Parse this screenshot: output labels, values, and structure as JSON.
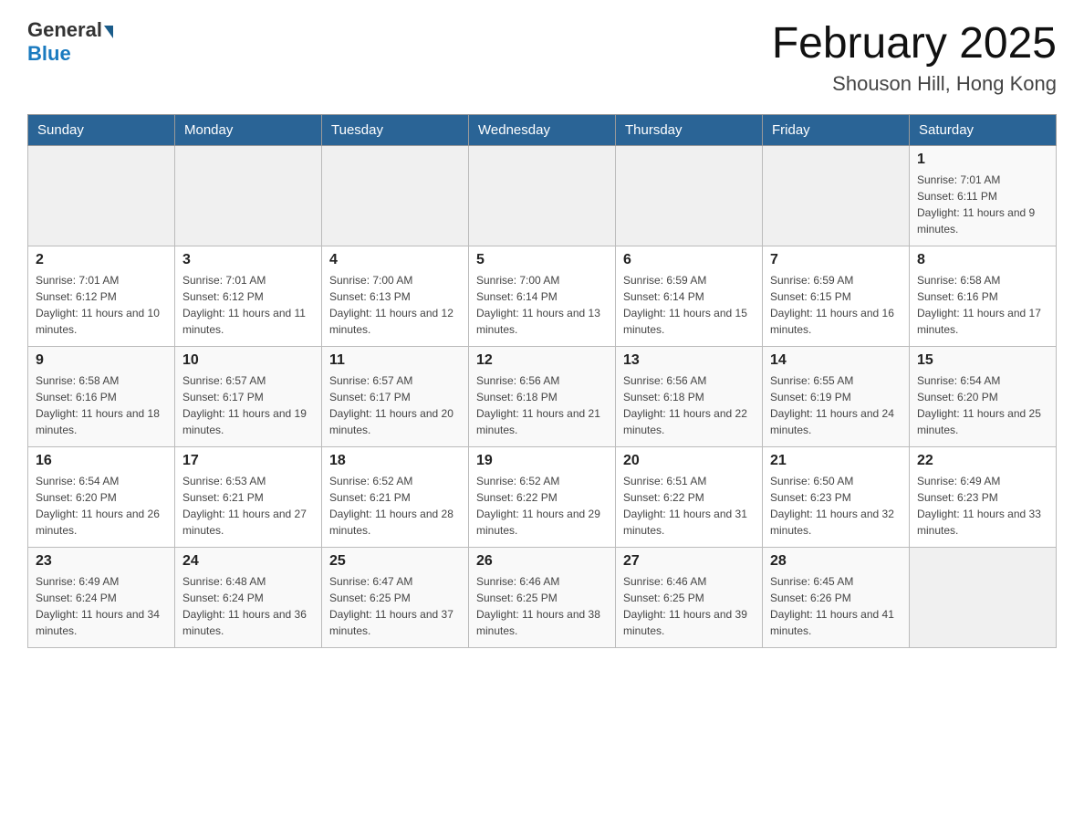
{
  "logo": {
    "general": "General",
    "blue": "Blue"
  },
  "header": {
    "month": "February 2025",
    "location": "Shouson Hill, Hong Kong"
  },
  "days_of_week": [
    "Sunday",
    "Monday",
    "Tuesday",
    "Wednesday",
    "Thursday",
    "Friday",
    "Saturday"
  ],
  "weeks": [
    [
      {
        "day": "",
        "sunrise": "",
        "sunset": "",
        "daylight": ""
      },
      {
        "day": "",
        "sunrise": "",
        "sunset": "",
        "daylight": ""
      },
      {
        "day": "",
        "sunrise": "",
        "sunset": "",
        "daylight": ""
      },
      {
        "day": "",
        "sunrise": "",
        "sunset": "",
        "daylight": ""
      },
      {
        "day": "",
        "sunrise": "",
        "sunset": "",
        "daylight": ""
      },
      {
        "day": "",
        "sunrise": "",
        "sunset": "",
        "daylight": ""
      },
      {
        "day": "1",
        "sunrise": "Sunrise: 7:01 AM",
        "sunset": "Sunset: 6:11 PM",
        "daylight": "Daylight: 11 hours and 9 minutes."
      }
    ],
    [
      {
        "day": "2",
        "sunrise": "Sunrise: 7:01 AM",
        "sunset": "Sunset: 6:12 PM",
        "daylight": "Daylight: 11 hours and 10 minutes."
      },
      {
        "day": "3",
        "sunrise": "Sunrise: 7:01 AM",
        "sunset": "Sunset: 6:12 PM",
        "daylight": "Daylight: 11 hours and 11 minutes."
      },
      {
        "day": "4",
        "sunrise": "Sunrise: 7:00 AM",
        "sunset": "Sunset: 6:13 PM",
        "daylight": "Daylight: 11 hours and 12 minutes."
      },
      {
        "day": "5",
        "sunrise": "Sunrise: 7:00 AM",
        "sunset": "Sunset: 6:14 PM",
        "daylight": "Daylight: 11 hours and 13 minutes."
      },
      {
        "day": "6",
        "sunrise": "Sunrise: 6:59 AM",
        "sunset": "Sunset: 6:14 PM",
        "daylight": "Daylight: 11 hours and 15 minutes."
      },
      {
        "day": "7",
        "sunrise": "Sunrise: 6:59 AM",
        "sunset": "Sunset: 6:15 PM",
        "daylight": "Daylight: 11 hours and 16 minutes."
      },
      {
        "day": "8",
        "sunrise": "Sunrise: 6:58 AM",
        "sunset": "Sunset: 6:16 PM",
        "daylight": "Daylight: 11 hours and 17 minutes."
      }
    ],
    [
      {
        "day": "9",
        "sunrise": "Sunrise: 6:58 AM",
        "sunset": "Sunset: 6:16 PM",
        "daylight": "Daylight: 11 hours and 18 minutes."
      },
      {
        "day": "10",
        "sunrise": "Sunrise: 6:57 AM",
        "sunset": "Sunset: 6:17 PM",
        "daylight": "Daylight: 11 hours and 19 minutes."
      },
      {
        "day": "11",
        "sunrise": "Sunrise: 6:57 AM",
        "sunset": "Sunset: 6:17 PM",
        "daylight": "Daylight: 11 hours and 20 minutes."
      },
      {
        "day": "12",
        "sunrise": "Sunrise: 6:56 AM",
        "sunset": "Sunset: 6:18 PM",
        "daylight": "Daylight: 11 hours and 21 minutes."
      },
      {
        "day": "13",
        "sunrise": "Sunrise: 6:56 AM",
        "sunset": "Sunset: 6:18 PM",
        "daylight": "Daylight: 11 hours and 22 minutes."
      },
      {
        "day": "14",
        "sunrise": "Sunrise: 6:55 AM",
        "sunset": "Sunset: 6:19 PM",
        "daylight": "Daylight: 11 hours and 24 minutes."
      },
      {
        "day": "15",
        "sunrise": "Sunrise: 6:54 AM",
        "sunset": "Sunset: 6:20 PM",
        "daylight": "Daylight: 11 hours and 25 minutes."
      }
    ],
    [
      {
        "day": "16",
        "sunrise": "Sunrise: 6:54 AM",
        "sunset": "Sunset: 6:20 PM",
        "daylight": "Daylight: 11 hours and 26 minutes."
      },
      {
        "day": "17",
        "sunrise": "Sunrise: 6:53 AM",
        "sunset": "Sunset: 6:21 PM",
        "daylight": "Daylight: 11 hours and 27 minutes."
      },
      {
        "day": "18",
        "sunrise": "Sunrise: 6:52 AM",
        "sunset": "Sunset: 6:21 PM",
        "daylight": "Daylight: 11 hours and 28 minutes."
      },
      {
        "day": "19",
        "sunrise": "Sunrise: 6:52 AM",
        "sunset": "Sunset: 6:22 PM",
        "daylight": "Daylight: 11 hours and 29 minutes."
      },
      {
        "day": "20",
        "sunrise": "Sunrise: 6:51 AM",
        "sunset": "Sunset: 6:22 PM",
        "daylight": "Daylight: 11 hours and 31 minutes."
      },
      {
        "day": "21",
        "sunrise": "Sunrise: 6:50 AM",
        "sunset": "Sunset: 6:23 PM",
        "daylight": "Daylight: 11 hours and 32 minutes."
      },
      {
        "day": "22",
        "sunrise": "Sunrise: 6:49 AM",
        "sunset": "Sunset: 6:23 PM",
        "daylight": "Daylight: 11 hours and 33 minutes."
      }
    ],
    [
      {
        "day": "23",
        "sunrise": "Sunrise: 6:49 AM",
        "sunset": "Sunset: 6:24 PM",
        "daylight": "Daylight: 11 hours and 34 minutes."
      },
      {
        "day": "24",
        "sunrise": "Sunrise: 6:48 AM",
        "sunset": "Sunset: 6:24 PM",
        "daylight": "Daylight: 11 hours and 36 minutes."
      },
      {
        "day": "25",
        "sunrise": "Sunrise: 6:47 AM",
        "sunset": "Sunset: 6:25 PM",
        "daylight": "Daylight: 11 hours and 37 minutes."
      },
      {
        "day": "26",
        "sunrise": "Sunrise: 6:46 AM",
        "sunset": "Sunset: 6:25 PM",
        "daylight": "Daylight: 11 hours and 38 minutes."
      },
      {
        "day": "27",
        "sunrise": "Sunrise: 6:46 AM",
        "sunset": "Sunset: 6:25 PM",
        "daylight": "Daylight: 11 hours and 39 minutes."
      },
      {
        "day": "28",
        "sunrise": "Sunrise: 6:45 AM",
        "sunset": "Sunset: 6:26 PM",
        "daylight": "Daylight: 11 hours and 41 minutes."
      },
      {
        "day": "",
        "sunrise": "",
        "sunset": "",
        "daylight": ""
      }
    ]
  ]
}
